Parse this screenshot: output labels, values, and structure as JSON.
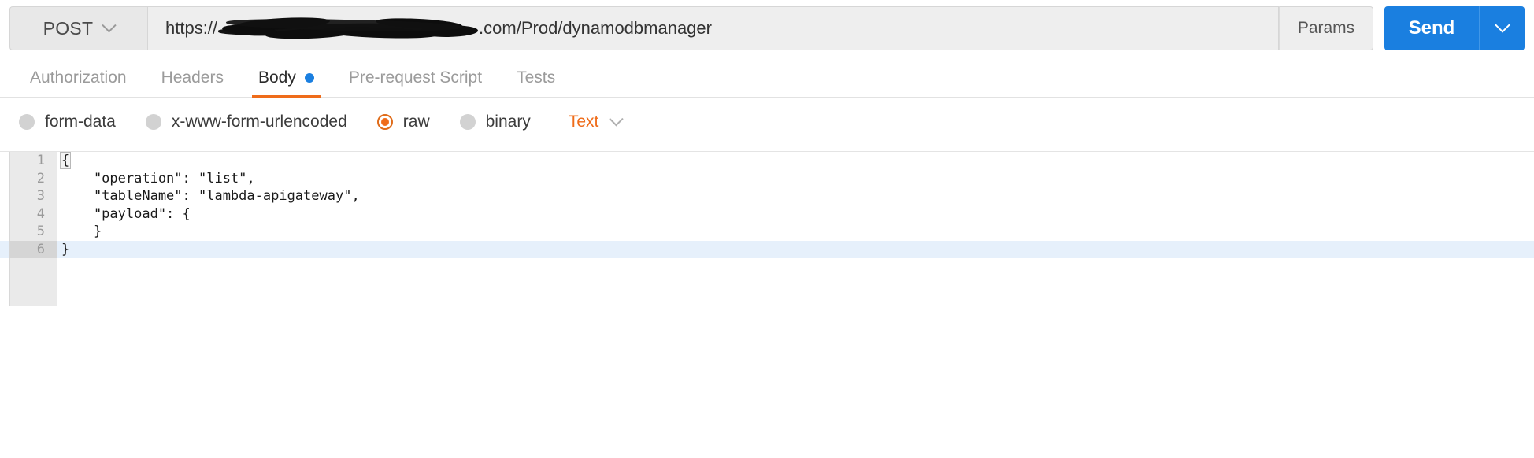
{
  "request_bar": {
    "method": "POST",
    "method_caret_icon": "chevron-down-icon",
    "url_prefix": "https://",
    "url_redacted": "",
    "url_suffix": ".com/Prod/dynamodbmanager",
    "url_full_visible": "https://[redacted]amazonaws.com/Prod/dynamodbmanager",
    "params_label": "Params",
    "send_label": "Send",
    "send_caret_icon": "chevron-down-icon",
    "send_color": "#1a7fe0"
  },
  "tabs": [
    {
      "label": "Authorization",
      "active": false,
      "dot": false
    },
    {
      "label": "Headers",
      "active": false,
      "dot": false
    },
    {
      "label": "Body",
      "active": true,
      "dot": true
    },
    {
      "label": "Pre-request Script",
      "active": false,
      "dot": false
    },
    {
      "label": "Tests",
      "active": false,
      "dot": false
    }
  ],
  "tab_accent_color": "#ef6c1a",
  "tab_dot_color": "#1a7fe0",
  "body_options": [
    {
      "label": "form-data",
      "selected": false
    },
    {
      "label": "x-www-form-urlencoded",
      "selected": false
    },
    {
      "label": "raw",
      "selected": true
    },
    {
      "label": "binary",
      "selected": false
    }
  ],
  "format_select": {
    "value": "Text",
    "caret_icon": "chevron-down-icon",
    "color": "#ef6c1a"
  },
  "editor": {
    "lines": [
      {
        "number": "1",
        "text": "{",
        "active": false,
        "bracket_highlight": true
      },
      {
        "number": "2",
        "text": "    \"operation\": \"list\",",
        "active": false,
        "bracket_highlight": false
      },
      {
        "number": "3",
        "text": "    \"tableName\": \"lambda-apigateway\",",
        "active": false,
        "bracket_highlight": false
      },
      {
        "number": "4",
        "text": "    \"payload\": {",
        "active": false,
        "bracket_highlight": false
      },
      {
        "number": "5",
        "text": "    }",
        "active": false,
        "bracket_highlight": false
      },
      {
        "number": "6",
        "text": "}",
        "active": true,
        "bracket_highlight": false
      }
    ],
    "active_line_color": "#e6f0fb",
    "gutter_color": "#eaeaea"
  }
}
